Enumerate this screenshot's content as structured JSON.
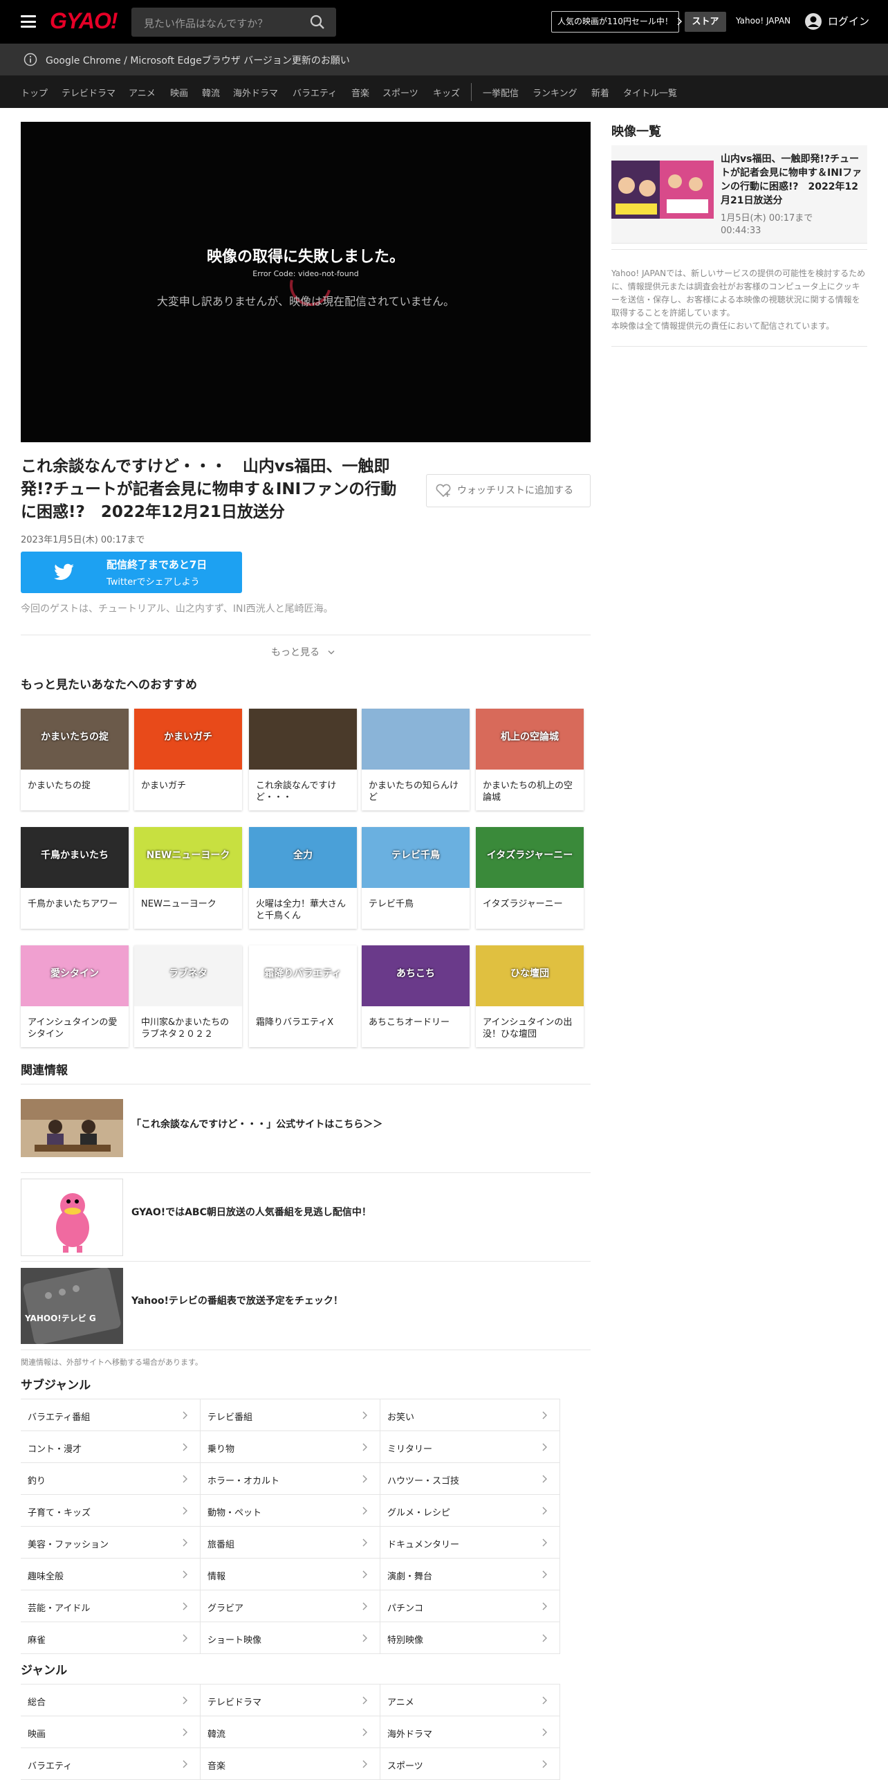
{
  "header": {
    "logo": "GYAO!",
    "search_placeholder": "見たい作品はなんですか？",
    "sale_text": "人気の映画が110円セール中！",
    "store_label": "ストア",
    "yahoo_japan": "Yahoo! JAPAN",
    "login_label": "ログイン"
  },
  "notice": "Google Chrome / Microsoft Edgeブラウザ バージョン更新のお願い",
  "nav": [
    "トップ",
    "テレビドラマ",
    "アニメ",
    "映画",
    "韓流",
    "海外ドラマ",
    "バラエティ",
    "音楽",
    "スポーツ",
    "キッズ",
    "一挙配信",
    "ランキング",
    "新着",
    "タイトル一覧"
  ],
  "player": {
    "error_title": "映像の取得に失敗しました。",
    "error_code": "Error Code: video-not-found",
    "error_message": "大変申し訳ありませんが、映像は現在配信されていません。"
  },
  "video": {
    "title_lines": [
      "これ余談なんですけど・・・　山内vs福田、一触即",
      "発!?チュートが記者会見に物申す＆INIファンの行動",
      "に困惑!?　2022年12月21日放送分"
    ],
    "watchlist_label": "ウォッチリストに追加する",
    "date": "2023年1月5日(木) 00:17まで",
    "twitter_line1": "配信終了まであと7日",
    "twitter_line2": "Twitterでシェアしよう",
    "description": "今回のゲストは、チュートリアル、山之内すず、INI西洸人と尾崎匠海。",
    "more_label": "もっと見る"
  },
  "recommend": {
    "title": "もっと見たいあなたへのおすすめ",
    "items": [
      {
        "title": "かまいたちの掟",
        "thumb": "かまいたちの掟",
        "color": "#6b5a4a"
      },
      {
        "title": "かまいガチ",
        "thumb": "かまいガチ",
        "color": "#e84a1a"
      },
      {
        "title": "これ余談なんですけど・・・",
        "thumb": "",
        "color": "#4a3a2a"
      },
      {
        "title": "かまいたちの知らんけど",
        "thumb": "",
        "color": "#8ab4d8"
      },
      {
        "title": "かまいたちの机上の空論城",
        "thumb": "机上の空論城",
        "color": "#d86a5a"
      },
      {
        "title": "千鳥かまいたちアワー",
        "thumb": "千鳥かまいたち",
        "color": "#2a2a2a"
      },
      {
        "title": "NEWニューヨーク",
        "thumb": "NEWニューヨーク",
        "color": "#c8e040"
      },
      {
        "title": "火曜は全力！華大さんと千鳥くん",
        "thumb": "全力",
        "color": "#4aa0d8"
      },
      {
        "title": "テレビ千鳥",
        "thumb": "テレビ千鳥",
        "color": "#6ab0e0"
      },
      {
        "title": "イタズラジャーニー",
        "thumb": "イタズラジャーニー",
        "color": "#3a8a3a"
      },
      {
        "title": "アインシュタインの愛シタイン",
        "thumb": "愛シタイン",
        "color": "#f0a0d0"
      },
      {
        "title": "中川家&かまいたちのラブネタ２０２２",
        "thumb": "ラブネタ",
        "color": "#f4f4f4"
      },
      {
        "title": "霜降りバラエティX",
        "thumb": "霜降りバラエティ",
        "color": "#ffffff"
      },
      {
        "title": "あちこちオードリー",
        "thumb": "あちこち",
        "color": "#6a3a8a"
      },
      {
        "title": "アインシュタインの出没！ひな壇団",
        "thumb": "ひな壇団",
        "color": "#e0c040"
      }
    ]
  },
  "related": {
    "title": "関連情報",
    "items": [
      {
        "text": "「これ余談なんですけど・・・」公式サイトはこちら＞＞"
      },
      {
        "text": "GYAO!ではABC朝日放送の人気番組を見逃し配信中！"
      },
      {
        "text": "Yahoo!テレビの番組表で放送予定をチェック！",
        "thumb": "YAHOO!テレビ G"
      }
    ],
    "note": "関連情報は、外部サイトへ移動する場合があります。"
  },
  "subgenre": {
    "title": "サブジャンル",
    "items": [
      "バラエティ番組",
      "テレビ番組",
      "お笑い",
      "コント・漫才",
      "乗り物",
      "ミリタリー",
      "釣り",
      "ホラー・オカルト",
      "ハウツー・スゴ技",
      "子育て・キッズ",
      "動物・ペット",
      "グルメ・レシピ",
      "美容・ファッション",
      "旅番組",
      "ドキュメンタリー",
      "趣味全般",
      "情報",
      "演劇・舞台",
      "芸能・アイドル",
      "グラビア",
      "パチンコ",
      "麻雀",
      "ショート映像",
      "特別映像"
    ]
  },
  "genre": {
    "title": "ジャンル",
    "items": [
      "総合",
      "テレビドラマ",
      "アニメ",
      "映画",
      "韓流",
      "海外ドラマ",
      "バラエティ",
      "音楽",
      "スポーツ"
    ]
  },
  "sidebar": {
    "title": "映像一覧",
    "card": {
      "title": "山内vs福田、一触即発!?チュートが記者会見に物申す＆INIファンの行動に困惑!?　2022年12月21日放送分",
      "date": "1月5日(木) 00:17まで",
      "duration": "00:44:33"
    },
    "note1": "Yahoo! JAPANでは、新しいサービスの提供の可能性を検討するために、情報提供元または調査会社がお客様のコンピュータ上にクッキーを送信・保存し、お客様による本映像の視聴状況に関する情報を取得することを許諾しています。",
    "note2": "本映像は全て情報提供元の責任において配信されています。"
  }
}
